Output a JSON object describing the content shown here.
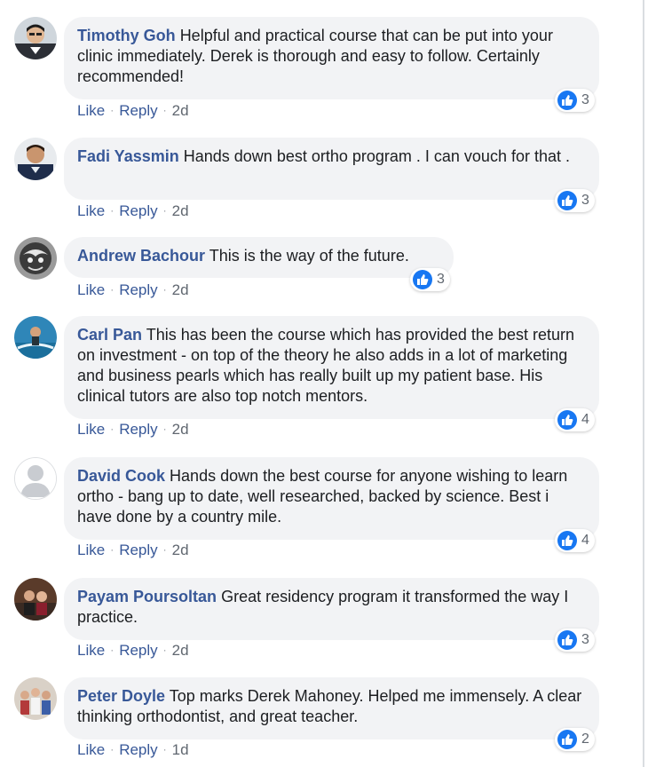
{
  "comments": [
    {
      "author": "Timothy Goh",
      "text": "Helpful and practical course that can be put into your clinic immediately. Derek is thorough and easy to follow. Certainly recommended!",
      "reactions": "3",
      "like": "Like",
      "reply": "Reply",
      "time": "2d"
    },
    {
      "author": "Fadi Yassmin",
      "text": "Hands down best ortho program . I can vouch for that .",
      "reactions": "3",
      "like": "Like",
      "reply": "Reply",
      "time": "2d"
    },
    {
      "author": "Andrew Bachour",
      "text": "This is the way of the future.",
      "reactions": "3",
      "like": "Like",
      "reply": "Reply",
      "time": "2d"
    },
    {
      "author": "Carl Pan",
      "text": "This has been the course which has provided the best return on investment - on top of the theory he also adds in a lot of marketing and business pearls which has really built up my patient base. His clinical tutors are also top notch mentors.",
      "reactions": "4",
      "like": "Like",
      "reply": "Reply",
      "time": "2d"
    },
    {
      "author": "David Cook",
      "text": "Hands down the best course for anyone wishing to learn ortho - bang up to date, well researched, backed by science. Best i have done by a country mile.",
      "reactions": "4",
      "like": "Like",
      "reply": "Reply",
      "time": "2d"
    },
    {
      "author": "Payam Poursoltan",
      "text": "Great residency program it transformed the way I practice.",
      "reactions": "3",
      "like": "Like",
      "reply": "Reply",
      "time": "2d"
    },
    {
      "author": "Peter Doyle",
      "text": "Top marks Derek Mahoney. Helped me immensely. A clear thinking orthodontist, and great teacher.",
      "reactions": "2",
      "like": "Like",
      "reply": "Reply",
      "time": "1d"
    }
  ],
  "colors": {
    "author_link": "#385898",
    "like_blue": "#1877f2",
    "bubble": "#f2f3f5",
    "meta_gray": "#606770"
  },
  "icons": {
    "reaction": "thumbs-up-icon"
  }
}
